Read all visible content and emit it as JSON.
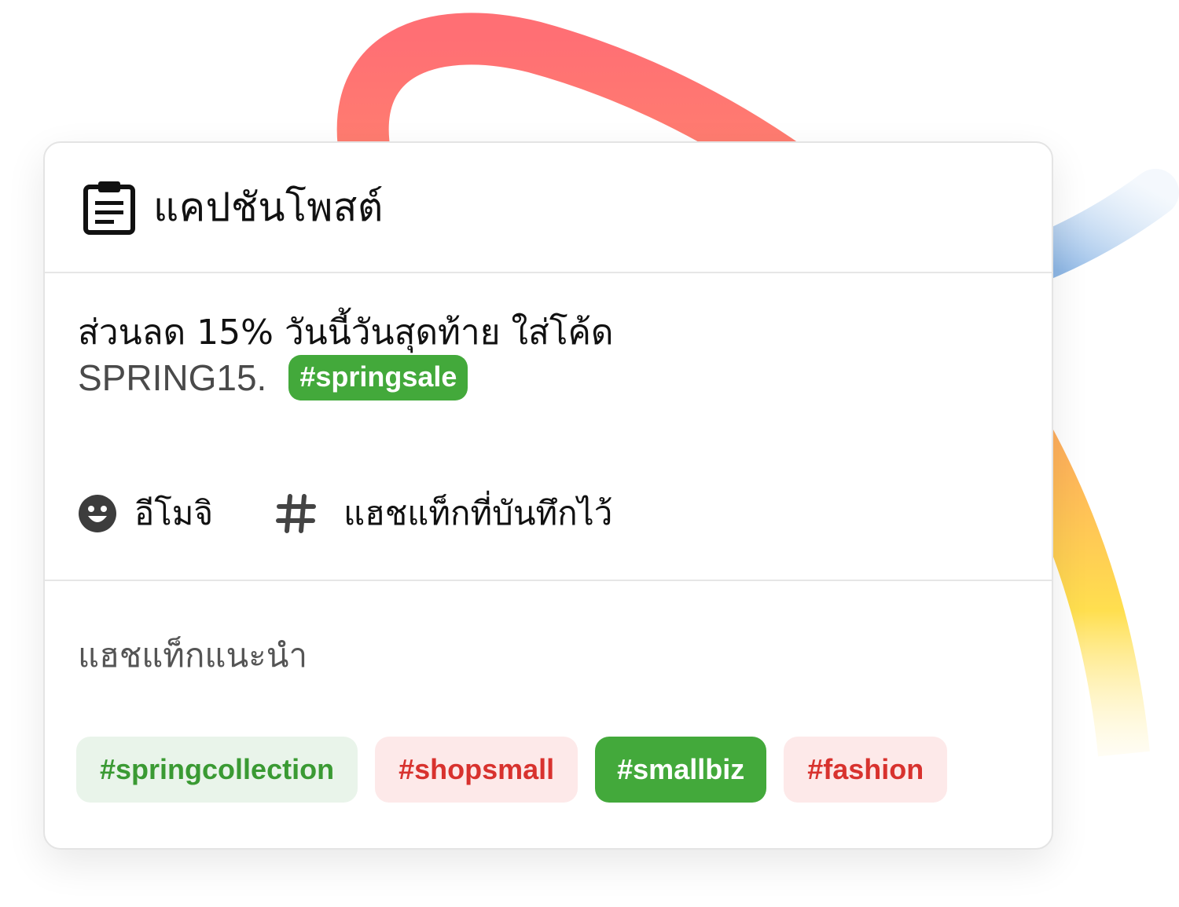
{
  "card": {
    "title": "แคปชันโพสต์",
    "title_icon": "clipboard-icon"
  },
  "post": {
    "line1": "ส่วนลด 15% วันนี้วันสุดท้าย ใส่โค้ด",
    "code": "SPRING15.",
    "inline_hashtag": "#springsale"
  },
  "toolbar": {
    "emoji_label": "อีโมจิ",
    "emoji_icon": "smiley-icon",
    "saved_hashtags_label": "แฮชแท็กที่บันทึกไว้",
    "saved_hashtags_icon": "hashtag-icon"
  },
  "suggestions": {
    "title": "แฮชแท็กแนะนำ",
    "chips": [
      {
        "label": "#springcollection",
        "style": "green-soft"
      },
      {
        "label": "#shopsmall",
        "style": "red-soft"
      },
      {
        "label": "#smallbiz",
        "style": "green-solid"
      },
      {
        "label": "#fashion",
        "style": "red-soft"
      }
    ]
  },
  "colors": {
    "accent_green": "#43a93b",
    "soft_green_bg": "#e9f4ea",
    "soft_red_bg": "#fde9e9",
    "red_text": "#d8322e"
  }
}
